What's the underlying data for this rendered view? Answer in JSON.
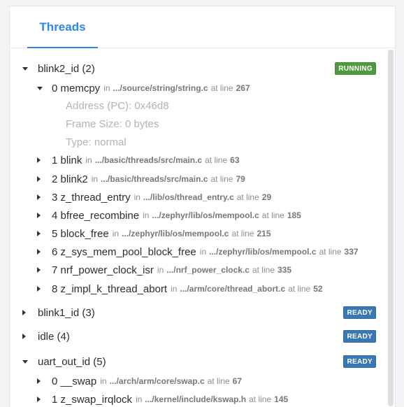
{
  "tabs": {
    "threads_label": "Threads"
  },
  "colors": {
    "accent": "#2f86e6",
    "running": "#4f9a3d",
    "ready": "#3a78b5"
  },
  "threads": [
    {
      "label": "blink2_id (2)",
      "status": "RUNNING",
      "expanded": true,
      "frames": [
        {
          "name": "0 memcpy",
          "in": "in",
          "path": ".../source/string/string.c",
          "atline": "at line",
          "line": "267",
          "expanded": true,
          "details": [
            "Address (PC): 0x46d8",
            "Frame Size: 0 bytes",
            "Type: normal"
          ]
        },
        {
          "name": "1 blink",
          "in": "in",
          "path": ".../basic/threads/src/main.c",
          "atline": "at line",
          "line": "63"
        },
        {
          "name": "2 blink2",
          "in": "in",
          "path": ".../basic/threads/src/main.c",
          "atline": "at line",
          "line": "79"
        },
        {
          "name": "3 z_thread_entry",
          "in": "in",
          "path": ".../lib/os/thread_entry.c",
          "atline": "at line",
          "line": "29"
        },
        {
          "name": "4 bfree_recombine",
          "in": "in",
          "path": ".../zephyr/lib/os/mempool.c",
          "atline": "at line",
          "line": "185"
        },
        {
          "name": "5 block_free",
          "in": "in",
          "path": ".../zephyr/lib/os/mempool.c",
          "atline": "at line",
          "line": "215"
        },
        {
          "name": "6 z_sys_mem_pool_block_free",
          "in": "in",
          "path": ".../zephyr/lib/os/mempool.c",
          "atline": "at line",
          "line": "337"
        },
        {
          "name": "7 nrf_power_clock_isr",
          "in": "in",
          "path": ".../nrf_power_clock.c",
          "atline": "at line",
          "line": "335"
        },
        {
          "name": "8 z_impl_k_thread_abort",
          "in": "in",
          "path": ".../arm/core/thread_abort.c",
          "atline": "at line",
          "line": "52"
        }
      ]
    },
    {
      "label": "blink1_id (3)",
      "status": "READY",
      "expanded": false
    },
    {
      "label": "idle (4)",
      "status": "READY",
      "expanded": false
    },
    {
      "label": "uart_out_id (5)",
      "status": "READY",
      "expanded": true,
      "frames": [
        {
          "name": "0 __swap",
          "in": "in",
          "path": ".../arch/arm/core/swap.c",
          "atline": "at line",
          "line": "67"
        },
        {
          "name": "1 z_swap_irqlock",
          "in": "in",
          "path": ".../kernel/include/kswap.h",
          "atline": "at line",
          "line": "145"
        }
      ]
    }
  ]
}
